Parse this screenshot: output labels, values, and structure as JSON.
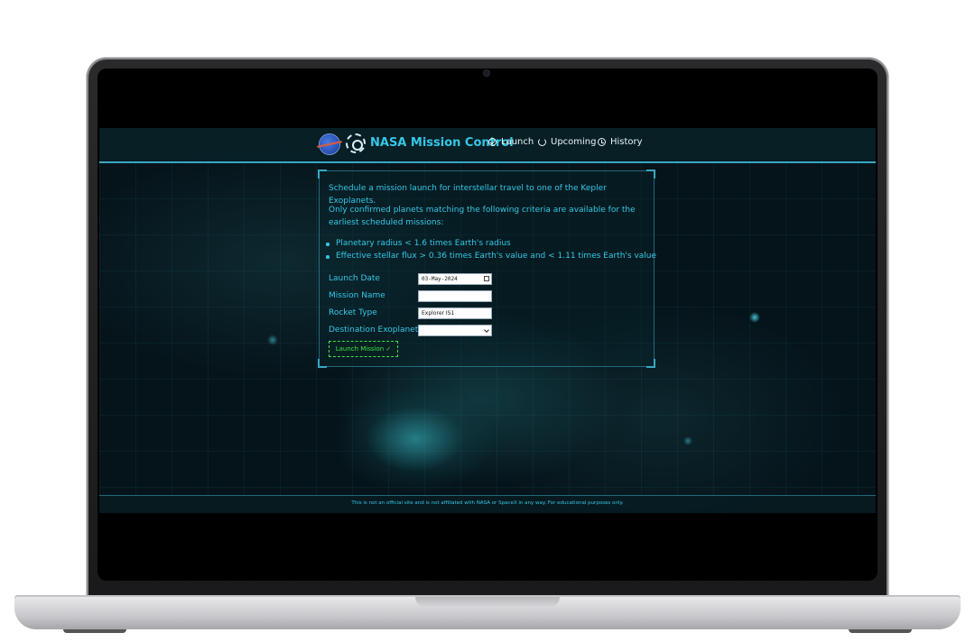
{
  "header": {
    "brand_title": "NASA Mission Control",
    "nav": [
      {
        "label": "Launch",
        "icon": "check-circle-icon"
      },
      {
        "label": "Upcoming",
        "icon": "refresh-icon"
      },
      {
        "label": "History",
        "icon": "history-icon"
      }
    ]
  },
  "panel": {
    "intro": "Schedule a mission launch for interstellar travel to one of the Kepler Exoplanets.",
    "criteria_intro": "Only confirmed planets matching the following criteria are available for the earliest scheduled missions:",
    "criteria": [
      "Planetary radius < 1.6 times Earth's radius",
      "Effective stellar flux > 0.36 times Earth's value and < 1.11 times Earth's value"
    ],
    "form": {
      "launch_date_label": "Launch Date",
      "launch_date_value": "03-May-2024",
      "mission_name_label": "Mission Name",
      "mission_name_value": "",
      "rocket_type_label": "Rocket Type",
      "rocket_type_value": "Explorer IS1",
      "destination_label": "Destination Exoplanet",
      "destination_value": "",
      "submit_label": "Launch Mission ✓"
    }
  },
  "footer": {
    "disclaimer": "This is not an official site and is not affiliated with NASA or SpaceX in any way. For educational purposes only."
  },
  "colors": {
    "accent": "#36c7e6",
    "border": "#3aa7c2",
    "button": "#3de04a",
    "background": "#05141a"
  }
}
